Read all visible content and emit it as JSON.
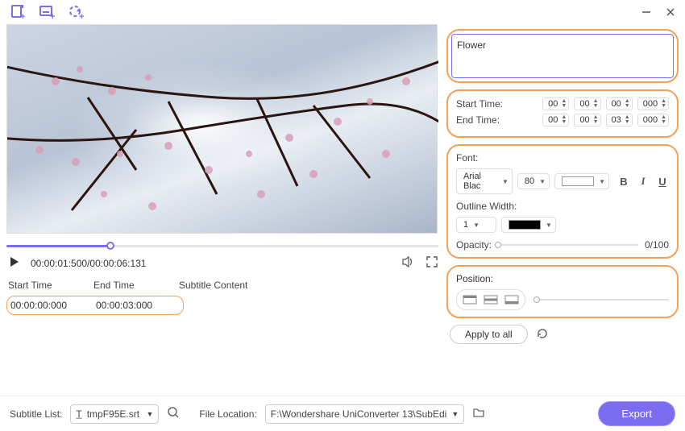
{
  "subtitle_text": "Flower",
  "start_time": {
    "label": "Start Time:",
    "h": "00",
    "m": "00",
    "s": "00",
    "ms": "000"
  },
  "end_time": {
    "label": "End Time:",
    "h": "00",
    "m": "00",
    "s": "03",
    "ms": "000"
  },
  "font": {
    "label": "Font:",
    "name": "Arial Blac",
    "size": "80",
    "outline_label": "Outline Width:",
    "outline_width": "1",
    "opacity_label": "Opacity:",
    "opacity_value": "0/100",
    "bold": "B",
    "italic": "I",
    "underline": "U"
  },
  "position": {
    "label": "Position:"
  },
  "apply_label": "Apply to all",
  "controls": {
    "timecode": "00:00:01:500/00:00:06:131"
  },
  "table": {
    "col_start": "Start Time",
    "col_end": "End Time",
    "col_content": "Subtitle Content",
    "row_start": "00:00:00:000",
    "row_end": "00:00:03:000"
  },
  "footer": {
    "subtitle_list_label": "Subtitle List:",
    "subtitle_file": "tmpF95E.srt",
    "location_label": "File Location:",
    "location_value": "F:\\Wondershare UniConverter 13\\SubEdi",
    "export": "Export"
  }
}
